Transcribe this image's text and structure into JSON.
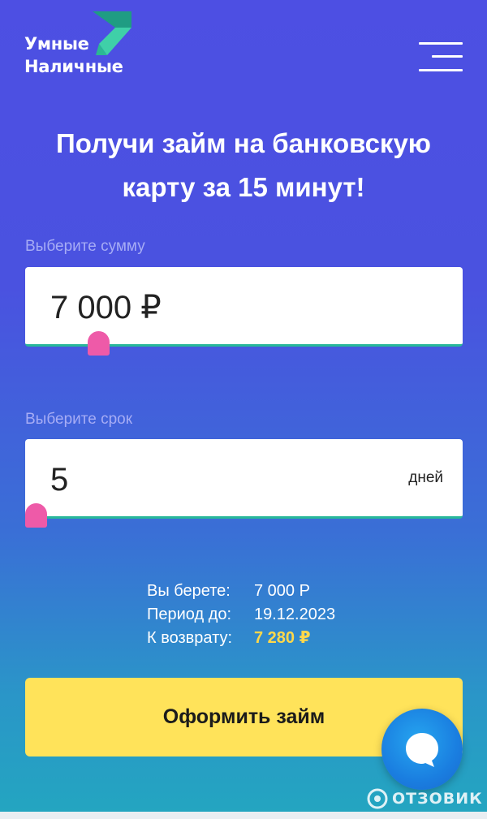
{
  "header": {
    "logo_line1": "Умные",
    "logo_line2": "Наличные",
    "menu_icon": "hamburger-menu-icon"
  },
  "hero": {
    "title_line1": "Получи займ на банковскую",
    "title_line2": "карту за 15 минут!"
  },
  "amount": {
    "label": "Выберите сумму",
    "value": "7 000 ₽",
    "slider_fraction": 0.15
  },
  "term": {
    "label": "Выберите срок",
    "value": "5",
    "unit": "дней",
    "slider_fraction": 0.0
  },
  "summary": {
    "rows": [
      {
        "key": "Вы берете:",
        "value": "7 000 Р"
      },
      {
        "key": "Период до:",
        "value": "19.12.2023"
      },
      {
        "key": "К возврату:",
        "value": "7 280 ₽"
      }
    ]
  },
  "cta": {
    "label": "Оформить займ"
  },
  "chat": {
    "icon": "chat-bubble-icon"
  },
  "watermark": {
    "text": "ОТЗОВИК"
  },
  "colors": {
    "background_top": "#4d4fe3",
    "background_bottom": "#23a6c0",
    "accent_yellow": "#ffe35a",
    "slider_pink": "#ee5aa8",
    "field_underline": "#28b89a"
  }
}
